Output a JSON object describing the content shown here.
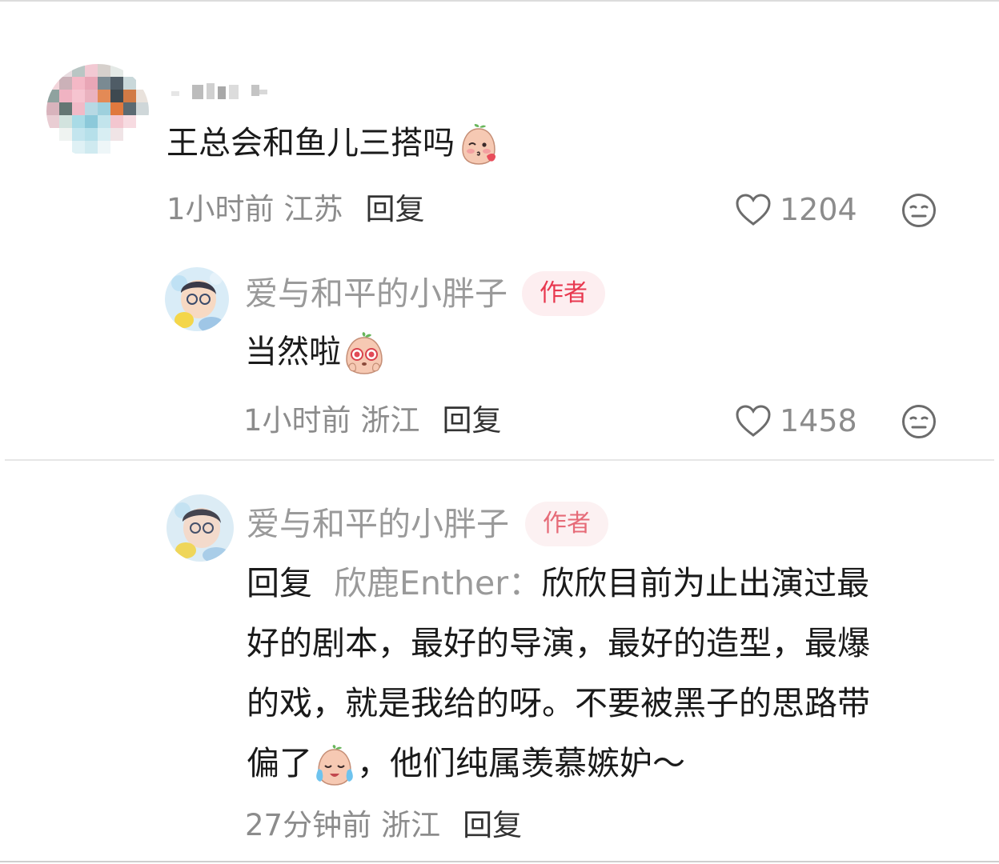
{
  "comments": [
    {
      "username": "·▪▪ ▪-",
      "text": "王总会和鱼儿三搭吗",
      "emoji": "blush-peach-emoji",
      "time": "1小时前",
      "location": "江苏",
      "reply_label": "回复",
      "likes": "1204",
      "like_icon": "heart-outline-icon",
      "dislike_icon": "meh-face-icon"
    },
    {
      "username": "爱与和平的小胖子",
      "badge": "作者",
      "text": "当然啦",
      "emoji": "starry-eyes-peach-emoji",
      "time": "1小时前",
      "location": "浙江",
      "reply_label": "回复",
      "likes": "1458",
      "like_icon": "heart-outline-icon",
      "dislike_icon": "meh-face-icon"
    },
    {
      "username": "爱与和平的小胖子",
      "badge": "作者",
      "reply_prefix": "回复",
      "reply_target": "欣鹿Enther：",
      "text_lines": [
        "欣欣目前为止出演过最",
        "好的剧本，最好的导演，最好的造型，最爆",
        "的戏，就是我给的呀。不要被黑子的思路带",
        "，他们纯属羡慕嫉妒～"
      ],
      "line4_prefix": "偏了",
      "emoji": "crying-peach-emoji",
      "time": "27分钟前",
      "location": "浙江",
      "reply_label": "回复"
    }
  ],
  "colors": {
    "badge_bg": "#fdeef0",
    "badge_text": "#e8384f",
    "meta_gray": "#8c8c8c",
    "username_gray": "#9a9a9a"
  }
}
